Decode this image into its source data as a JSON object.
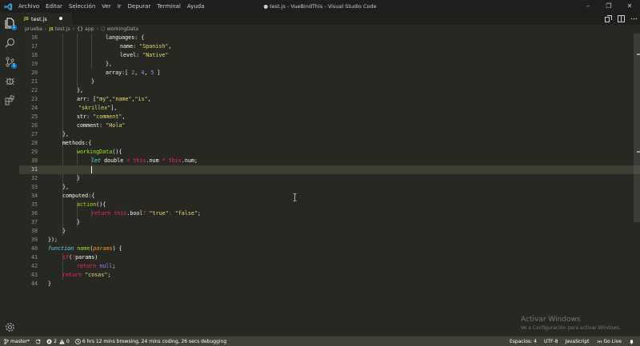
{
  "window": {
    "title": "● test.js - VueBindThis - Visual Studio Code",
    "menu": [
      "Archivo",
      "Editar",
      "Selección",
      "Ver",
      "Ir",
      "Depurar",
      "Terminal",
      "Ayuda"
    ]
  },
  "activity": {
    "explorer_badge": "1",
    "scm_badge": "1"
  },
  "tab": {
    "icon": "JS",
    "name": "test.js"
  },
  "breadcrumb": {
    "folder": "prueba",
    "file_icon": "JS",
    "file": "test.js",
    "symbol1": "app",
    "symbol2": "workingData"
  },
  "editor": {
    "current_line": "31",
    "lines": [
      {
        "num": "16"
      },
      {
        "num": "17"
      },
      {
        "num": "18"
      },
      {
        "num": "19"
      },
      {
        "num": "20"
      },
      {
        "num": "21"
      },
      {
        "num": "22"
      },
      {
        "num": "23"
      },
      {
        "num": "24"
      },
      {
        "num": "25"
      },
      {
        "num": "26"
      },
      {
        "num": "27"
      },
      {
        "num": "28"
      },
      {
        "num": "29"
      },
      {
        "num": "30"
      },
      {
        "num": "31"
      },
      {
        "num": "32"
      },
      {
        "num": "33"
      },
      {
        "num": "34"
      },
      {
        "num": "35"
      },
      {
        "num": "36"
      },
      {
        "num": "37"
      },
      {
        "num": "38"
      },
      {
        "num": "39"
      },
      {
        "num": "40"
      },
      {
        "num": "41"
      },
      {
        "num": "42"
      },
      {
        "num": "43"
      },
      {
        "num": "44"
      }
    ],
    "code": {
      "l16": "languages: {",
      "l17a": "name: ",
      "l17b": "\"Spanish\"",
      "l17c": ",",
      "l18a": "level: ",
      "l18b": "\"Native\"",
      "l19": "},",
      "l20a": "array:[ ",
      "l20b": "2",
      "l20c": ", ",
      "l20d": "4",
      "l20e": ", ",
      "l20f": "5",
      "l20g": " ]",
      "l21": "}",
      "l22": "},",
      "l23a": "arr: [",
      "l23b": "\"my\"",
      "l23c": ",",
      "l23d": "\"name\"",
      "l23e": ",",
      "l23f": "\"is\"",
      "l23g": ",",
      "l24a": "\"skrillex\"",
      "l24b": "],",
      "l25a": "str: ",
      "l25b": "\"comment\"",
      "l25c": ",",
      "l26a": "comment: ",
      "l26b": "\"Hola\"",
      "l27": "},",
      "l28": "methods:{",
      "l29a": "workingData",
      "l29b": "(){",
      "l30a": "let",
      "l30b": " double ",
      "l30c": "=",
      "l30d": " this",
      "l30e": ".num ",
      "l30f": "*",
      "l30g": " this",
      "l30h": ".num;",
      "l32": "}",
      "l33": "},",
      "l34": "computed:{",
      "l35a": "action",
      "l35b": "(){",
      "l36a": "return",
      "l36b": " this",
      "l36c": ".bool",
      "l36d": "?",
      "l36e": " \"true\"",
      "l36f": ": ",
      "l36g": "\"false\"",
      "l36h": ";",
      "l37": "}",
      "l38": "}",
      "l39": "});",
      "l40a": "function",
      "l40b": " name",
      "l40c": "(",
      "l40d": "params",
      "l40e": ") {",
      "l41a": "if",
      "l41b": "(",
      "l41c": "!",
      "l41d": "params)",
      "l42a": "return",
      "l42b": " null",
      "l42c": ";",
      "l43a": "return",
      "l43b": " \"cosas\"",
      "l43c": ";",
      "l44": "}"
    }
  },
  "watermark": {
    "title": "Activar Windows",
    "subtitle": "Ve a Configuración para activar Windows."
  },
  "status": {
    "branch": "master*",
    "errors": "2",
    "warnings": "0",
    "time": "6 hrs 12 mins browsing, 24 mins coding, 26 secs debugging",
    "spaces": "Espacios: 4",
    "encoding": "UTF-8",
    "language": "JavaScript",
    "golive": "Go Live"
  },
  "colors": {
    "editor_bg": "#272822",
    "status_bg": "#414339",
    "keyword": "#f92672",
    "string": "#e6db74",
    "number": "#ae81ff",
    "function": "#a6e22e",
    "storage": "#66d9ef"
  }
}
